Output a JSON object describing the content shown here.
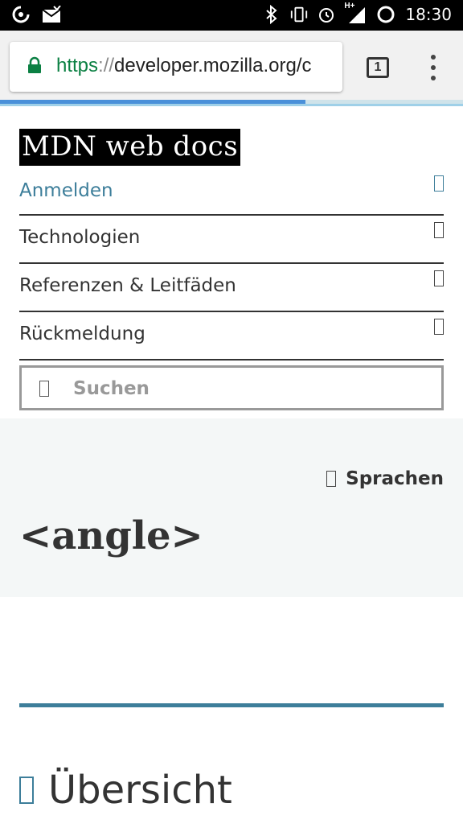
{
  "status_bar": {
    "time": "18:30",
    "icons": [
      "sync-icon",
      "mail-icon",
      "bluetooth-icon",
      "vibrate-icon",
      "alarm-icon",
      "signal-icon",
      "battery-icon"
    ],
    "network_label": "H+"
  },
  "browser": {
    "url_scheme": "https",
    "url_sep": "://",
    "url_rest": "developer.mozilla.org/c",
    "tab_count": "1",
    "progress_percent": 66,
    "colors": {
      "secure": "#0b8043",
      "progress": "#4a90d9"
    }
  },
  "site": {
    "logo": "MDN web docs",
    "nav": [
      {
        "label": "Anmelden"
      },
      {
        "label": "Technologien"
      },
      {
        "label": "Referenzen & Leitfäden"
      },
      {
        "label": "Rückmeldung"
      }
    ],
    "search_placeholder": "Suchen",
    "languages_label": "Sprachen",
    "page_title": "<angle>",
    "section_heading": "Übersicht",
    "colors": {
      "link": "#3d7e9a",
      "hero_bg": "#f4f7f7",
      "text": "#333333"
    }
  }
}
